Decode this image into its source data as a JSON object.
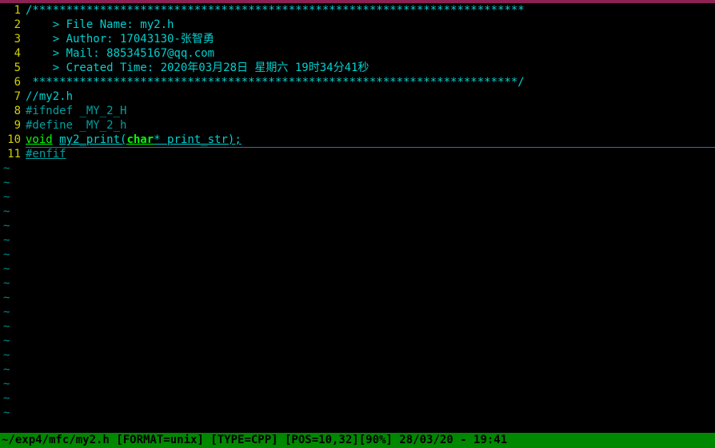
{
  "editor": {
    "lines": [
      {
        "num": "1",
        "segments": [
          {
            "cls": "c-comment",
            "t": "/*************************************************************************"
          }
        ]
      },
      {
        "num": "2",
        "segments": [
          {
            "cls": "c-comment",
            "t": "    > File Name: my2.h"
          }
        ]
      },
      {
        "num": "3",
        "segments": [
          {
            "cls": "c-comment",
            "t": "    > Author: 17043130-张智勇"
          }
        ]
      },
      {
        "num": "4",
        "segments": [
          {
            "cls": "c-comment",
            "t": "    > Mail: 885345167@qq.com "
          }
        ]
      },
      {
        "num": "5",
        "segments": [
          {
            "cls": "c-comment",
            "t": "    > Created Time: 2020年03月28日 星期六 19时34分41秒"
          }
        ]
      },
      {
        "num": "6",
        "segments": [
          {
            "cls": "c-comment",
            "t": " ************************************************************************/"
          }
        ]
      },
      {
        "num": "7",
        "segments": [
          {
            "cls": "c-plain",
            "t": "//my2.h"
          }
        ]
      },
      {
        "num": "8",
        "segments": [
          {
            "cls": "c-pre",
            "t": "#ifndef _MY_2_H"
          }
        ]
      },
      {
        "num": "9",
        "segments": [
          {
            "cls": "c-pre",
            "t": "#define _MY_2_h"
          }
        ]
      },
      {
        "num": "10",
        "cursor": true,
        "segments": [
          {
            "cls": "c-keyword",
            "t": "void"
          },
          {
            "cls": "",
            "t": " "
          },
          {
            "cls": "c-func",
            "t": "my2_print("
          },
          {
            "cls": "c-type",
            "t": "char"
          },
          {
            "cls": "c-param",
            "t": "* print_str);"
          }
        ]
      },
      {
        "num": "11",
        "segments": [
          {
            "cls": "c-err",
            "t": "#enfif"
          }
        ]
      }
    ],
    "tilde_count": 18,
    "tilde": "~"
  },
  "status": {
    "text": "~/exp4/mfc/my2.h [FORMAT=unix] [TYPE=CPP] [POS=10,32][90%] 28/03/20 - 19:41"
  }
}
